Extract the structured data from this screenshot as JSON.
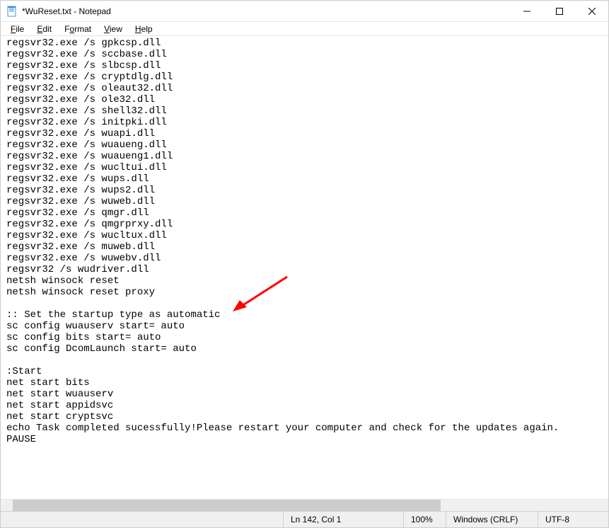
{
  "window": {
    "title": "*WuReset.txt - Notepad"
  },
  "menu": {
    "file": "File",
    "edit": "Edit",
    "format": "Format",
    "view": "View",
    "help": "Help"
  },
  "editor": {
    "content": "regsvr32.exe /s gpkcsp.dll\nregsvr32.exe /s sccbase.dll\nregsvr32.exe /s slbcsp.dll\nregsvr32.exe /s cryptdlg.dll\nregsvr32.exe /s oleaut32.dll\nregsvr32.exe /s ole32.dll\nregsvr32.exe /s shell32.dll\nregsvr32.exe /s initpki.dll\nregsvr32.exe /s wuapi.dll\nregsvr32.exe /s wuaueng.dll\nregsvr32.exe /s wuaueng1.dll\nregsvr32.exe /s wucltui.dll\nregsvr32.exe /s wups.dll\nregsvr32.exe /s wups2.dll\nregsvr32.exe /s wuweb.dll\nregsvr32.exe /s qmgr.dll\nregsvr32.exe /s qmgrprxy.dll\nregsvr32.exe /s wucltux.dll\nregsvr32.exe /s muweb.dll\nregsvr32.exe /s wuwebv.dll\nregsvr32 /s wudriver.dll\nnetsh winsock reset\nnetsh winsock reset proxy\n\n:: Set the startup type as automatic\nsc config wuauserv start= auto\nsc config bits start= auto\nsc config DcomLaunch start= auto\n\n:Start\nnet start bits\nnet start wuauserv\nnet start appidsvc\nnet start cryptsvc\necho Task completed sucessfully!Please restart your computer and check for the updates again.\nPAUSE"
  },
  "statusbar": {
    "position": "Ln 142, Col 1",
    "zoom": "100%",
    "line_ending": "Windows (CRLF)",
    "encoding": "UTF-8"
  }
}
